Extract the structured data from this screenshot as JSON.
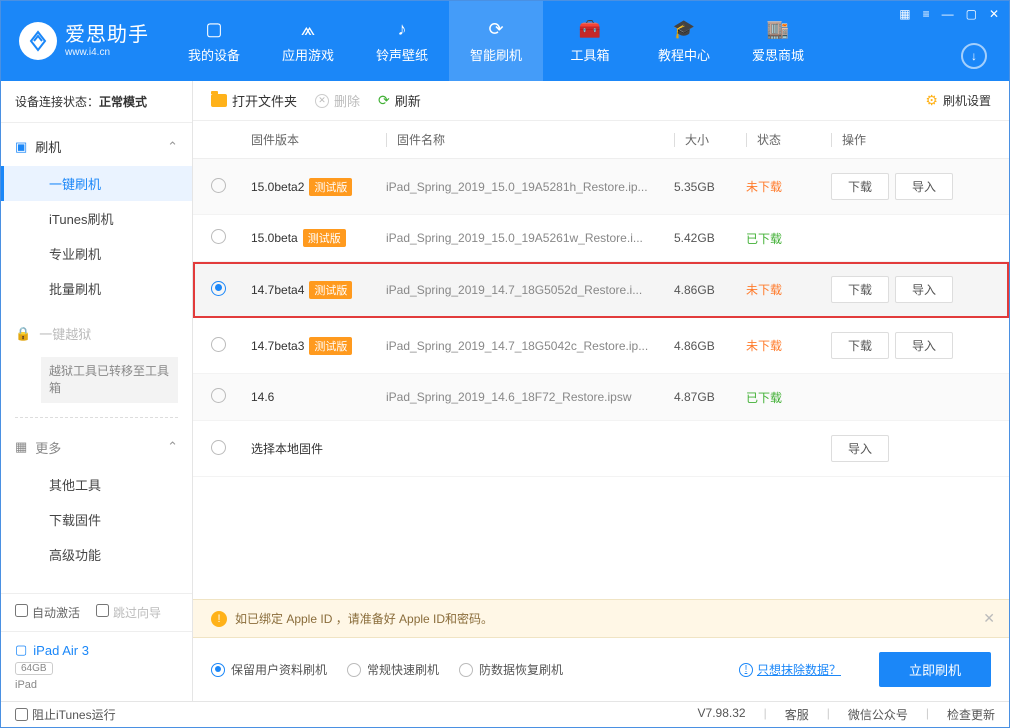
{
  "app": {
    "title": "爱思助手",
    "site": "www.i4.cn"
  },
  "nav": {
    "items": [
      {
        "label": "我的设备"
      },
      {
        "label": "应用游戏"
      },
      {
        "label": "铃声壁纸"
      },
      {
        "label": "智能刷机"
      },
      {
        "label": "工具箱"
      },
      {
        "label": "教程中心"
      },
      {
        "label": "爱思商城"
      }
    ]
  },
  "sidebar": {
    "conn_label": "设备连接状态：",
    "conn_value": "正常模式",
    "flash_head": "刷机",
    "flash_items": [
      "一键刷机",
      "iTunes刷机",
      "专业刷机",
      "批量刷机"
    ],
    "jailbreak_head": "一键越狱",
    "jailbreak_note": "越狱工具已转移至工具箱",
    "more_head": "更多",
    "more_items": [
      "其他工具",
      "下载固件",
      "高级功能"
    ],
    "auto_activate": "自动激活",
    "skip_guide": "跳过向导",
    "device_name": "iPad Air 3",
    "device_cap": "64GB",
    "device_type": "iPad"
  },
  "toolbar": {
    "open_folder": "打开文件夹",
    "delete": "删除",
    "refresh": "刷新",
    "settings": "刷机设置"
  },
  "columns": {
    "version": "固件版本",
    "name": "固件名称",
    "size": "大小",
    "status": "状态",
    "ops": "操作"
  },
  "badge_beta": "测试版",
  "btn_download": "下载",
  "btn_import": "导入",
  "rows": [
    {
      "ver": "15.0beta2",
      "beta": true,
      "name": "iPad_Spring_2019_15.0_19A5281h_Restore.ip...",
      "size": "5.35GB",
      "status": "未下载",
      "status_cls": "nd",
      "ops": true,
      "sel": false
    },
    {
      "ver": "15.0beta",
      "beta": true,
      "name": "iPad_Spring_2019_15.0_19A5261w_Restore.i...",
      "size": "5.42GB",
      "status": "已下载",
      "status_cls": "dl",
      "ops": false,
      "sel": false
    },
    {
      "ver": "14.7beta4",
      "beta": true,
      "name": "iPad_Spring_2019_14.7_18G5052d_Restore.i...",
      "size": "4.86GB",
      "status": "未下载",
      "status_cls": "nd",
      "ops": true,
      "sel": true
    },
    {
      "ver": "14.7beta3",
      "beta": true,
      "name": "iPad_Spring_2019_14.7_18G5042c_Restore.ip...",
      "size": "4.86GB",
      "status": "未下载",
      "status_cls": "nd",
      "ops": true,
      "sel": false
    },
    {
      "ver": "14.6",
      "beta": false,
      "name": "iPad_Spring_2019_14.6_18F72_Restore.ipsw",
      "size": "4.87GB",
      "status": "已下载",
      "status_cls": "dl",
      "ops": false,
      "sel": false
    }
  ],
  "local_row": "选择本地固件",
  "banner": "如已绑定 Apple ID ，请准备好 Apple ID和密码。",
  "options": {
    "keep": "保留用户资料刷机",
    "fast": "常规快速刷机",
    "antil": "防数据恢复刷机",
    "link": "只想抹除数据？",
    "go": "立即刷机"
  },
  "statusbar": {
    "block_itunes": "阻止iTunes运行",
    "version": "V7.98.32",
    "kefu": "客服",
    "wechat": "微信公众号",
    "update": "检查更新"
  }
}
